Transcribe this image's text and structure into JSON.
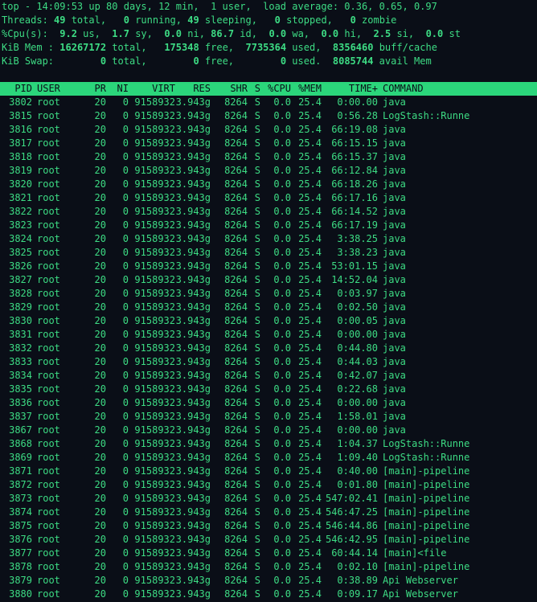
{
  "summary": {
    "top": {
      "prefix": "top - ",
      "time": "14:09:53",
      "uptime": " up 80 days, 12 min,  1 user,  load average: 0.36, 0.65, 0.97"
    },
    "tasks": {
      "label": "Threads:",
      "total": "49",
      "total_label": " total,",
      "running": "0",
      "running_label": " running,",
      "sleeping": "49",
      "sleeping_label": " sleeping,",
      "stopped": "0",
      "stopped_label": " stopped,",
      "zombie": "0",
      "zombie_label": " zombie"
    },
    "cpu": {
      "label": "%Cpu(s):",
      "us": "9.2",
      "us_label": " us,",
      "sy": "1.7",
      "sy_label": " sy,",
      "ni": "0.0",
      "ni_label": " ni,",
      "id": "86.7",
      "id_label": " id,",
      "wa": "0.0",
      "wa_label": " wa,",
      "hi": "0.0",
      "hi_label": " hi,",
      "si": "2.5",
      "si_label": " si,",
      "st": "0.0",
      "st_label": " st"
    },
    "mem": {
      "label": "KiB Mem :",
      "total": "16267172",
      "total_label": " total,",
      "free": "175348",
      "free_label": " free,",
      "used": "7735364",
      "used_label": " used,",
      "cache": "8356460",
      "cache_label": " buff/cache"
    },
    "swap": {
      "label": "KiB Swap:",
      "total": "0",
      "total_label": " total,",
      "free": "0",
      "free_label": " free,",
      "used": "0",
      "used_label": " used.",
      "avail": "8085744",
      "avail_label": " avail Mem"
    }
  },
  "columns": {
    "pid": "PID",
    "user": "USER",
    "pr": "PR",
    "ni": "NI",
    "virt": "VIRT",
    "res": "RES",
    "shr": "SHR",
    "s": "S",
    "cpu": "%CPU",
    "mem": "%MEM",
    "time": "TIME+",
    "command": "COMMAND"
  },
  "processes": [
    {
      "pid": "3802",
      "user": "root",
      "pr": "20",
      "ni": "0",
      "virt": "9158932",
      "res": "3.943g",
      "shr": "8264",
      "s": "S",
      "cpu": "0.0",
      "mem": "25.4",
      "time": "0:00.00",
      "command": "java"
    },
    {
      "pid": "3815",
      "user": "root",
      "pr": "20",
      "ni": "0",
      "virt": "9158932",
      "res": "3.943g",
      "shr": "8264",
      "s": "S",
      "cpu": "0.0",
      "mem": "25.4",
      "time": "0:56.28",
      "command": "LogStash::Runne"
    },
    {
      "pid": "3816",
      "user": "root",
      "pr": "20",
      "ni": "0",
      "virt": "9158932",
      "res": "3.943g",
      "shr": "8264",
      "s": "S",
      "cpu": "0.0",
      "mem": "25.4",
      "time": "66:19.08",
      "command": "java"
    },
    {
      "pid": "3817",
      "user": "root",
      "pr": "20",
      "ni": "0",
      "virt": "9158932",
      "res": "3.943g",
      "shr": "8264",
      "s": "S",
      "cpu": "0.0",
      "mem": "25.4",
      "time": "66:15.15",
      "command": "java"
    },
    {
      "pid": "3818",
      "user": "root",
      "pr": "20",
      "ni": "0",
      "virt": "9158932",
      "res": "3.943g",
      "shr": "8264",
      "s": "S",
      "cpu": "0.0",
      "mem": "25.4",
      "time": "66:15.37",
      "command": "java"
    },
    {
      "pid": "3819",
      "user": "root",
      "pr": "20",
      "ni": "0",
      "virt": "9158932",
      "res": "3.943g",
      "shr": "8264",
      "s": "S",
      "cpu": "0.0",
      "mem": "25.4",
      "time": "66:12.84",
      "command": "java"
    },
    {
      "pid": "3820",
      "user": "root",
      "pr": "20",
      "ni": "0",
      "virt": "9158932",
      "res": "3.943g",
      "shr": "8264",
      "s": "S",
      "cpu": "0.0",
      "mem": "25.4",
      "time": "66:18.26",
      "command": "java"
    },
    {
      "pid": "3821",
      "user": "root",
      "pr": "20",
      "ni": "0",
      "virt": "9158932",
      "res": "3.943g",
      "shr": "8264",
      "s": "S",
      "cpu": "0.0",
      "mem": "25.4",
      "time": "66:17.16",
      "command": "java"
    },
    {
      "pid": "3822",
      "user": "root",
      "pr": "20",
      "ni": "0",
      "virt": "9158932",
      "res": "3.943g",
      "shr": "8264",
      "s": "S",
      "cpu": "0.0",
      "mem": "25.4",
      "time": "66:14.52",
      "command": "java"
    },
    {
      "pid": "3823",
      "user": "root",
      "pr": "20",
      "ni": "0",
      "virt": "9158932",
      "res": "3.943g",
      "shr": "8264",
      "s": "S",
      "cpu": "0.0",
      "mem": "25.4",
      "time": "66:17.19",
      "command": "java"
    },
    {
      "pid": "3824",
      "user": "root",
      "pr": "20",
      "ni": "0",
      "virt": "9158932",
      "res": "3.943g",
      "shr": "8264",
      "s": "S",
      "cpu": "0.0",
      "mem": "25.4",
      "time": "3:38.25",
      "command": "java"
    },
    {
      "pid": "3825",
      "user": "root",
      "pr": "20",
      "ni": "0",
      "virt": "9158932",
      "res": "3.943g",
      "shr": "8264",
      "s": "S",
      "cpu": "0.0",
      "mem": "25.4",
      "time": "3:38.23",
      "command": "java"
    },
    {
      "pid": "3826",
      "user": "root",
      "pr": "20",
      "ni": "0",
      "virt": "9158932",
      "res": "3.943g",
      "shr": "8264",
      "s": "S",
      "cpu": "0.0",
      "mem": "25.4",
      "time": "53:01.15",
      "command": "java"
    },
    {
      "pid": "3827",
      "user": "root",
      "pr": "20",
      "ni": "0",
      "virt": "9158932",
      "res": "3.943g",
      "shr": "8264",
      "s": "S",
      "cpu": "0.0",
      "mem": "25.4",
      "time": "14:52.04",
      "command": "java"
    },
    {
      "pid": "3828",
      "user": "root",
      "pr": "20",
      "ni": "0",
      "virt": "9158932",
      "res": "3.943g",
      "shr": "8264",
      "s": "S",
      "cpu": "0.0",
      "mem": "25.4",
      "time": "0:03.97",
      "command": "java"
    },
    {
      "pid": "3829",
      "user": "root",
      "pr": "20",
      "ni": "0",
      "virt": "9158932",
      "res": "3.943g",
      "shr": "8264",
      "s": "S",
      "cpu": "0.0",
      "mem": "25.4",
      "time": "0:02.50",
      "command": "java"
    },
    {
      "pid": "3830",
      "user": "root",
      "pr": "20",
      "ni": "0",
      "virt": "9158932",
      "res": "3.943g",
      "shr": "8264",
      "s": "S",
      "cpu": "0.0",
      "mem": "25.4",
      "time": "0:00.05",
      "command": "java"
    },
    {
      "pid": "3831",
      "user": "root",
      "pr": "20",
      "ni": "0",
      "virt": "9158932",
      "res": "3.943g",
      "shr": "8264",
      "s": "S",
      "cpu": "0.0",
      "mem": "25.4",
      "time": "0:00.00",
      "command": "java"
    },
    {
      "pid": "3832",
      "user": "root",
      "pr": "20",
      "ni": "0",
      "virt": "9158932",
      "res": "3.943g",
      "shr": "8264",
      "s": "S",
      "cpu": "0.0",
      "mem": "25.4",
      "time": "0:44.80",
      "command": "java"
    },
    {
      "pid": "3833",
      "user": "root",
      "pr": "20",
      "ni": "0",
      "virt": "9158932",
      "res": "3.943g",
      "shr": "8264",
      "s": "S",
      "cpu": "0.0",
      "mem": "25.4",
      "time": "0:44.03",
      "command": "java"
    },
    {
      "pid": "3834",
      "user": "root",
      "pr": "20",
      "ni": "0",
      "virt": "9158932",
      "res": "3.943g",
      "shr": "8264",
      "s": "S",
      "cpu": "0.0",
      "mem": "25.4",
      "time": "0:42.07",
      "command": "java"
    },
    {
      "pid": "3835",
      "user": "root",
      "pr": "20",
      "ni": "0",
      "virt": "9158932",
      "res": "3.943g",
      "shr": "8264",
      "s": "S",
      "cpu": "0.0",
      "mem": "25.4",
      "time": "0:22.68",
      "command": "java"
    },
    {
      "pid": "3836",
      "user": "root",
      "pr": "20",
      "ni": "0",
      "virt": "9158932",
      "res": "3.943g",
      "shr": "8264",
      "s": "S",
      "cpu": "0.0",
      "mem": "25.4",
      "time": "0:00.00",
      "command": "java"
    },
    {
      "pid": "3837",
      "user": "root",
      "pr": "20",
      "ni": "0",
      "virt": "9158932",
      "res": "3.943g",
      "shr": "8264",
      "s": "S",
      "cpu": "0.0",
      "mem": "25.4",
      "time": "1:58.01",
      "command": "java"
    },
    {
      "pid": "3867",
      "user": "root",
      "pr": "20",
      "ni": "0",
      "virt": "9158932",
      "res": "3.943g",
      "shr": "8264",
      "s": "S",
      "cpu": "0.0",
      "mem": "25.4",
      "time": "0:00.00",
      "command": "java"
    },
    {
      "pid": "3868",
      "user": "root",
      "pr": "20",
      "ni": "0",
      "virt": "9158932",
      "res": "3.943g",
      "shr": "8264",
      "s": "S",
      "cpu": "0.0",
      "mem": "25.4",
      "time": "1:04.37",
      "command": "LogStash::Runne"
    },
    {
      "pid": "3869",
      "user": "root",
      "pr": "20",
      "ni": "0",
      "virt": "9158932",
      "res": "3.943g",
      "shr": "8264",
      "s": "S",
      "cpu": "0.0",
      "mem": "25.4",
      "time": "1:09.40",
      "command": "LogStash::Runne"
    },
    {
      "pid": "3871",
      "user": "root",
      "pr": "20",
      "ni": "0",
      "virt": "9158932",
      "res": "3.943g",
      "shr": "8264",
      "s": "S",
      "cpu": "0.0",
      "mem": "25.4",
      "time": "0:40.00",
      "command": "[main]-pipeline"
    },
    {
      "pid": "3872",
      "user": "root",
      "pr": "20",
      "ni": "0",
      "virt": "9158932",
      "res": "3.943g",
      "shr": "8264",
      "s": "S",
      "cpu": "0.0",
      "mem": "25.4",
      "time": "0:01.80",
      "command": "[main]-pipeline"
    },
    {
      "pid": "3873",
      "user": "root",
      "pr": "20",
      "ni": "0",
      "virt": "9158932",
      "res": "3.943g",
      "shr": "8264",
      "s": "S",
      "cpu": "0.0",
      "mem": "25.4",
      "time": "547:02.41",
      "command": "[main]-pipeline"
    },
    {
      "pid": "3874",
      "user": "root",
      "pr": "20",
      "ni": "0",
      "virt": "9158932",
      "res": "3.943g",
      "shr": "8264",
      "s": "S",
      "cpu": "0.0",
      "mem": "25.4",
      "time": "546:47.25",
      "command": "[main]-pipeline"
    },
    {
      "pid": "3875",
      "user": "root",
      "pr": "20",
      "ni": "0",
      "virt": "9158932",
      "res": "3.943g",
      "shr": "8264",
      "s": "S",
      "cpu": "0.0",
      "mem": "25.4",
      "time": "546:44.86",
      "command": "[main]-pipeline"
    },
    {
      "pid": "3876",
      "user": "root",
      "pr": "20",
      "ni": "0",
      "virt": "9158932",
      "res": "3.943g",
      "shr": "8264",
      "s": "S",
      "cpu": "0.0",
      "mem": "25.4",
      "time": "546:42.95",
      "command": "[main]-pipeline"
    },
    {
      "pid": "3877",
      "user": "root",
      "pr": "20",
      "ni": "0",
      "virt": "9158932",
      "res": "3.943g",
      "shr": "8264",
      "s": "S",
      "cpu": "0.0",
      "mem": "25.4",
      "time": "60:44.14",
      "command": "[main]<file"
    },
    {
      "pid": "3878",
      "user": "root",
      "pr": "20",
      "ni": "0",
      "virt": "9158932",
      "res": "3.943g",
      "shr": "8264",
      "s": "S",
      "cpu": "0.0",
      "mem": "25.4",
      "time": "0:02.10",
      "command": "[main]-pipeline"
    },
    {
      "pid": "3879",
      "user": "root",
      "pr": "20",
      "ni": "0",
      "virt": "9158932",
      "res": "3.943g",
      "shr": "8264",
      "s": "S",
      "cpu": "0.0",
      "mem": "25.4",
      "time": "0:38.89",
      "command": "Api Webserver"
    },
    {
      "pid": "3880",
      "user": "root",
      "pr": "20",
      "ni": "0",
      "virt": "9158932",
      "res": "3.943g",
      "shr": "8264",
      "s": "S",
      "cpu": "0.0",
      "mem": "25.4",
      "time": "0:09.17",
      "command": "Api Webserver"
    }
  ],
  "colors": {
    "background": "#0a0e17",
    "foreground": "#3ddc84",
    "header_bg": "#2bd67b"
  }
}
